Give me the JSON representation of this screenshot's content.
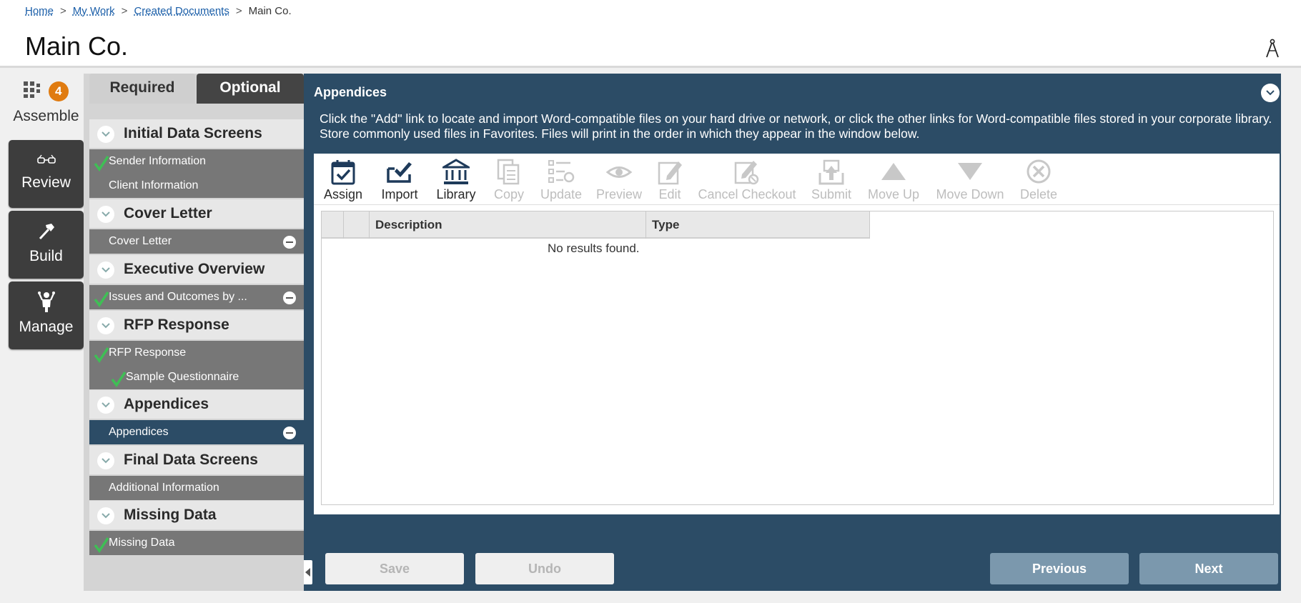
{
  "breadcrumb": {
    "items": [
      "Home",
      "My Work",
      "Created Documents"
    ],
    "separator": ">",
    "current": "Main Co."
  },
  "page": {
    "title": "Main Co."
  },
  "nav": {
    "assemble": {
      "label": "Assemble",
      "badge": "4"
    },
    "review": {
      "label": "Review"
    },
    "build": {
      "label": "Build"
    },
    "manage": {
      "label": "Manage"
    }
  },
  "tabs": {
    "required": "Required",
    "optional": "Optional"
  },
  "sections": [
    {
      "title": "Initial Data Screens",
      "items": [
        "Sender Information",
        "Client Information"
      ]
    },
    {
      "title": "Cover Letter",
      "items": [
        "Cover Letter"
      ]
    },
    {
      "title": "Executive Overview",
      "items": [
        "Issues and Outcomes by ..."
      ]
    },
    {
      "title": "RFP Response",
      "items": [
        "RFP Response",
        "Sample Questionnaire"
      ]
    },
    {
      "title": "Appendices",
      "items": [
        "Appendices"
      ]
    },
    {
      "title": "Final Data Screens",
      "items": [
        "Additional Information"
      ]
    },
    {
      "title": "Missing Data",
      "items": [
        "Missing Data"
      ]
    }
  ],
  "main": {
    "title": "Appendices",
    "instructions": "Click the \"Add\" link to locate and import Word-compatible files on your hard drive or network, or click the other links for Word-compatible files stored in your corporate library. Store commonly used files in Favorites. Files will print in the order in which they appear in the window below.",
    "toolbar": {
      "assign": "Assign",
      "import": "Import",
      "library": "Library",
      "copy": "Copy",
      "update": "Update",
      "preview": "Preview",
      "edit": "Edit",
      "cancel_checkout": "Cancel Checkout",
      "submit": "Submit",
      "move_up": "Move Up",
      "move_down": "Move Down",
      "delete": "Delete"
    },
    "grid": {
      "columns": [
        "Description",
        "Type"
      ],
      "empty_text": "No results found."
    },
    "buttons": {
      "save": "Save",
      "undo": "Undo",
      "previous": "Previous",
      "next": "Next"
    }
  },
  "colors": {
    "panel": "#2c4c66",
    "badge": "#e07b10",
    "check": "#3fbf55",
    "nav_dark": "#3d3d3d",
    "item_grey": "#777777",
    "button_blue": "#7b98ad"
  }
}
